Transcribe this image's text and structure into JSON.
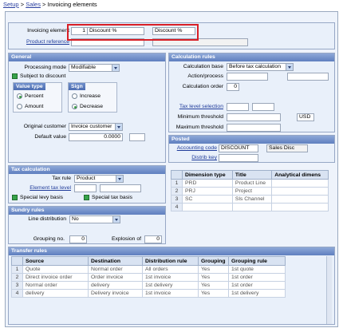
{
  "breadcrumb": {
    "setup": "Setup",
    "sales": "Sales",
    "current": "Invoicing elements",
    "sep": ">"
  },
  "header": {
    "invoicing_element_label": "Invoicing element",
    "element_number": "1",
    "element_name": "Discount %",
    "element_short": "Discount %",
    "product_reference_label": "Product reference"
  },
  "general": {
    "title": "General",
    "processing_mode_label": "Processing mode",
    "processing_mode": "Modifiable",
    "subject_to_discount": "Subject to discount",
    "value_type_title": "Value type",
    "percent": "Percent",
    "amount": "Amount",
    "sign_title": "Sign",
    "increase": "Increase",
    "decrease": "Decrease",
    "original_customer_label": "Original customer",
    "original_customer": "Invoice customer",
    "default_value_label": "Default value",
    "default_value": "0.0000"
  },
  "calc": {
    "title": "Calculation rules",
    "base_label": "Calculation base",
    "base": "Before tax calculation",
    "action_label": "Action/process",
    "order_label": "Calculation order",
    "order": "0",
    "tax_level_label": "Tax level selection",
    "min_label": "Minimum threshold",
    "max_label": "Maximum threshold",
    "currency": "USD"
  },
  "posted": {
    "title": "Posted",
    "acct_label": "Accounting code",
    "acct": "DISCOUNT",
    "acct_desc": "Sales Disc",
    "distrib_label": "Distrib key"
  },
  "tax": {
    "title": "Tax calculation",
    "tax_rule_label": "Tax rule",
    "tax_rule": "Product",
    "element_tax_label": "Element tax level",
    "levy": "Special levy basis",
    "special_tax": "Special tax basis"
  },
  "dimension_table": {
    "headers": [
      "Dimension type",
      "Title",
      "Analytical dimens"
    ],
    "rows": [
      [
        "1",
        "PRD",
        "Product Line",
        ""
      ],
      [
        "2",
        "PRJ",
        "Project",
        ""
      ],
      [
        "3",
        "SC",
        "Sls Channel",
        ""
      ],
      [
        "4",
        "",
        "",
        ""
      ]
    ]
  },
  "sundry": {
    "title": "Sundry rules",
    "line_dist_label": "Line distribution",
    "line_dist": "No",
    "grouping_label": "Grouping no.",
    "grouping": "0",
    "explosion_label": "Explosion of",
    "explosion": "0"
  },
  "transfer": {
    "title": "Transfer rules",
    "headers": [
      "Source",
      "Destination",
      "Distribution rule",
      "Grouping",
      "Grouping rule"
    ],
    "rows": [
      [
        "1",
        "Quote",
        "Normal order",
        "All orders",
        "Yes",
        "1st quote"
      ],
      [
        "2",
        "Direct invoice order",
        "Order invoice",
        "1st invoice",
        "Yes",
        "1st order"
      ],
      [
        "3",
        "Normal order",
        "delivery",
        "1st delivery",
        "Yes",
        "1st order"
      ],
      [
        "4",
        "delivery",
        "Delivery invoice",
        "1st invoice",
        "Yes",
        "1st delivery"
      ]
    ]
  }
}
